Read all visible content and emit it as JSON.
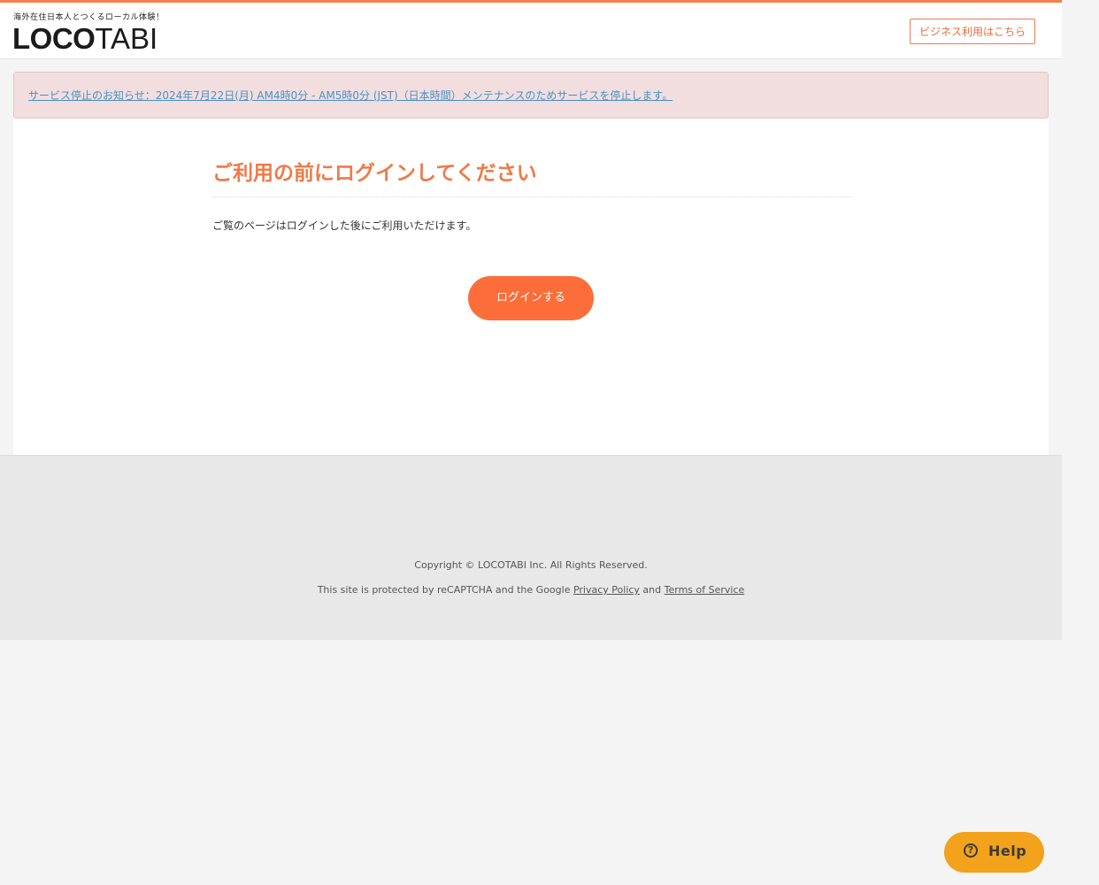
{
  "header": {
    "tagline": "海外在住日本人とつくるローカル体験！",
    "logo_bold": "LOCO",
    "logo_light": "TABI",
    "business_button": "ビジネス利用はこちら"
  },
  "notice": {
    "text": "サービス停止のお知らせ：2024年7月22日(月) AM4時0分 - AM5時0分 (JST)（日本時間）メンテナンスのためサービスを停止します。"
  },
  "main": {
    "title": "ご利用の前にログインしてください",
    "description": "ご覧のページはログインした後にご利用いただけます。",
    "login_button": "ログインする"
  },
  "footer": {
    "copyright": "Copyright © LOCOTABI Inc. All Rights Reserved.",
    "recaptcha_prefix": "This site is protected by reCAPTCHA and the Google ",
    "privacy_link": "Privacy Policy",
    "recaptcha_and": " and ",
    "terms_link": "Terms of Service"
  },
  "help": {
    "label": "Help",
    "icon": "question-circle-icon"
  },
  "colors": {
    "accent": "#f57f4c",
    "button": "#fd6d39",
    "notice_bg": "#f2dede",
    "help_bg": "#f2a21b"
  }
}
